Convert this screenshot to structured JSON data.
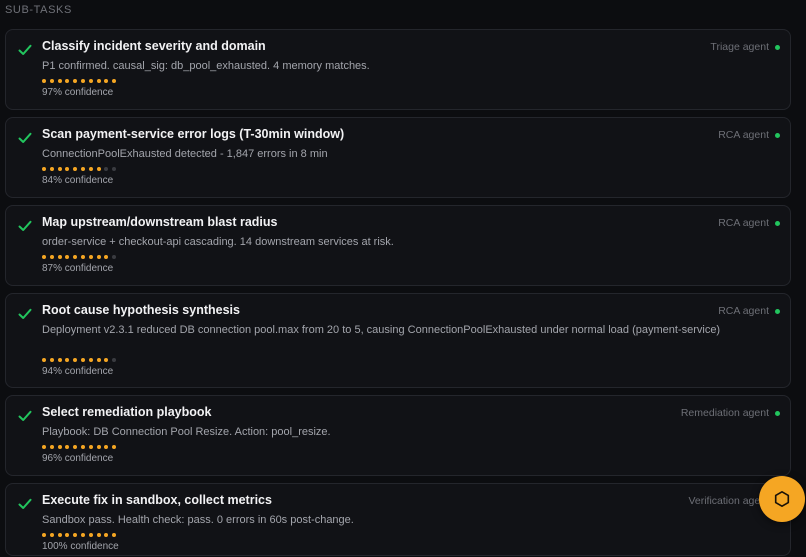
{
  "section": {
    "title": "SUB-TASKS"
  },
  "colors": {
    "accent": "#f5a623",
    "success": "#22c55e",
    "dot_off": "#3a3b40"
  },
  "tasks": [
    {
      "title": "Classify incident severity and domain",
      "detail": "P1 confirmed. causal_sig: db_pool_exhausted. 4 memory matches.",
      "agent": "Triage agent",
      "confidence": 0.97,
      "confidence_label": "97% confidence",
      "dots_filled": 10,
      "status_icon": "check-icon"
    },
    {
      "title": "Scan payment-service error logs (T-30min window)",
      "detail": "ConnectionPoolExhausted detected - 1,847 errors in 8 min",
      "agent": "RCA agent",
      "confidence": 0.84,
      "confidence_label": "84% confidence",
      "dots_filled": 8,
      "status_icon": "check-icon"
    },
    {
      "title": "Map upstream/downstream blast radius",
      "detail": "order-service + checkout-api cascading. 14 downstream services at risk.",
      "agent": "RCA agent",
      "confidence": 0.87,
      "confidence_label": "87% confidence",
      "dots_filled": 9,
      "status_icon": "check-icon"
    },
    {
      "title": "Root cause hypothesis synthesis",
      "detail": "Deployment v2.3.1 reduced DB connection pool.max from 20 to 5, causing ConnectionPoolExhausted under normal load (payment-service)",
      "agent": "RCA agent",
      "confidence": 0.94,
      "confidence_label": "94% confidence",
      "dots_filled": 9,
      "status_icon": "check-icon"
    },
    {
      "title": "Select remediation playbook",
      "detail": "Playbook: DB Connection Pool Resize. Action: pool_resize.",
      "agent": "Remediation agent",
      "confidence": 0.96,
      "confidence_label": "96% confidence",
      "dots_filled": 10,
      "status_icon": "check-icon"
    },
    {
      "title": "Execute fix in sandbox, collect metrics",
      "detail": "Sandbox pass. Health check: pass. 0 errors in 60s post-change.",
      "agent": "Verification agent",
      "confidence": 1.0,
      "confidence_label": "100% confidence",
      "dots_filled": 10,
      "status_icon": "check-icon"
    }
  ],
  "fab": {
    "icon": "hexagon-icon",
    "glyph": "⬡"
  }
}
